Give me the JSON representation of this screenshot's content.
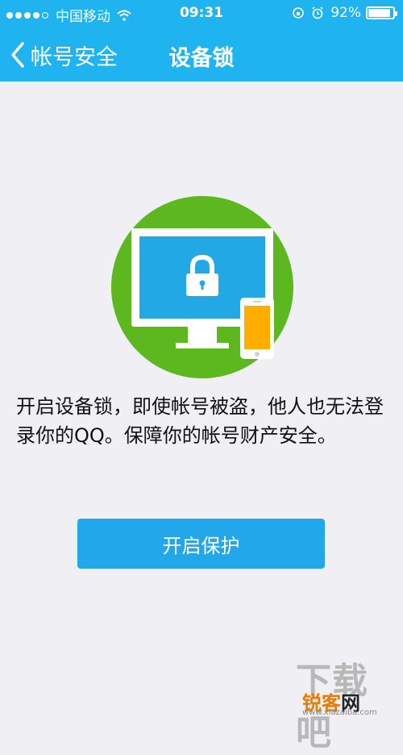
{
  "status": {
    "carrier": "中国移动",
    "time": "09:31",
    "battery": "92%"
  },
  "nav": {
    "back_label": "帐号安全",
    "title": "设备锁"
  },
  "content": {
    "description": "开启设备锁，即使帐号被盗，他人也无法登录你的QQ。保障你的帐号财产安全。",
    "button_label": "开启保护"
  },
  "watermark": {
    "big": "下载吧",
    "brand_a": "锐客",
    "brand_b": "网",
    "url": "www.xiazaiba.com"
  },
  "colors": {
    "header": "#1fb3f0",
    "button": "#22a8ea",
    "hero_circle": "#5cb81e",
    "screen": "#22a9e5",
    "phone_screen": "#ffae00"
  },
  "icons": [
    "signal-dots-icon",
    "wifi-icon",
    "rotation-lock-icon",
    "alarm-icon",
    "battery-icon",
    "back-chevron-icon",
    "device-lock-illustration"
  ]
}
